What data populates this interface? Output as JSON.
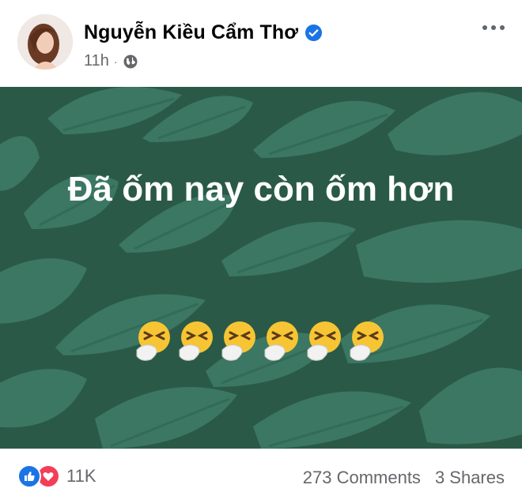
{
  "post": {
    "author": "Nguyễn Kiều Cẩm Thơ",
    "time": "11h",
    "separator": "·",
    "privacy_icon": "globe-icon",
    "verified_icon": "verified-badge-icon",
    "text": "Đã ốm nay còn ốm hơn",
    "emoji_icon": "sneezing-face-emoji",
    "emoji_count": 6,
    "background_color": "#2a5a47",
    "leaf_color": "#3f7d69"
  },
  "engagement": {
    "reaction_count": "11K",
    "comments": "273 Comments",
    "shares": "3 Shares",
    "like_color": "#1b74e4",
    "love_color": "#f33e58"
  }
}
